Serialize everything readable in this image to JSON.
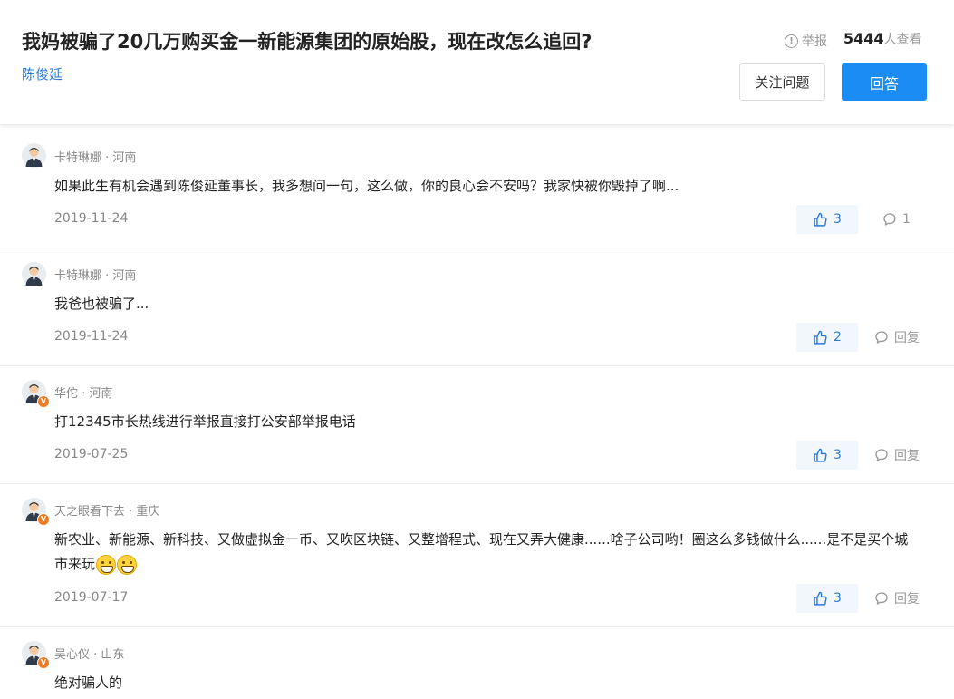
{
  "question": {
    "title": "我妈被骗了20几万购买金一新能源集团的原始股，现在改怎么追回?",
    "author": "陈俊延",
    "report_label": "举报",
    "view_count": "5444",
    "view_suffix": "人查看",
    "follow_label": "关注问题",
    "answer_label": "回答"
  },
  "colors": {
    "link": "#2d7ad6",
    "primary_button": "#1a8cf4",
    "verified_badge": "#f17a1f"
  },
  "icons": {
    "report": "exclamation-circle-icon",
    "like": "thumbs-up-icon",
    "comment": "comment-bubble-icon",
    "avatar": "user-avatar-icon",
    "verified": "verified-v-badge-icon",
    "emoji": "grinning-face-icon"
  },
  "comments": [
    {
      "name": "卡特琳娜",
      "sep": " · ",
      "location": "河南",
      "verified": false,
      "text": "如果此生有机会遇到陈俊延董事长，我多想问一句，这么做，你的良心会不安吗？我家快被你毁掉了啊...",
      "date": "2019-11-24",
      "likes": "3",
      "reply": "1"
    },
    {
      "name": "卡特琳娜",
      "sep": " · ",
      "location": "河南",
      "verified": false,
      "text": "我爸也被骗了...",
      "date": "2019-11-24",
      "likes": "2",
      "reply": "回复"
    },
    {
      "name": "华佗",
      "sep": " · ",
      "location": "河南",
      "verified": true,
      "text": "打12345市长热线进行举报直接打公安部举报电话",
      "date": "2019-07-25",
      "likes": "3",
      "reply": "回复"
    },
    {
      "name": "天之眼看下去",
      "sep": " · ",
      "location": "重庆",
      "verified": true,
      "text": "新农业、新能源、新科技、又做虚拟金一币、又吹区块链、又整增程式、现在又弄大健康......啥子公司哟！圈这么多钱做什么......是不是买个城市来玩",
      "emojis": 2,
      "date": "2019-07-17",
      "likes": "3",
      "reply": "回复"
    },
    {
      "name": "吴心仪",
      "sep": " · ",
      "location": "山东",
      "verified": true,
      "text": "绝对骗人的",
      "date": "",
      "likes": "",
      "reply": ""
    }
  ]
}
